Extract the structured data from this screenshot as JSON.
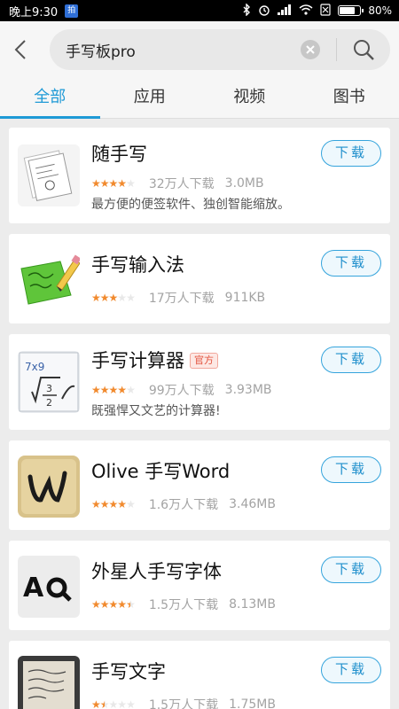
{
  "status_bar": {
    "time": "晚上9:30",
    "notif": "拍",
    "battery": "80%",
    "battery_level": 0.8
  },
  "search": {
    "query": "手写板pro"
  },
  "tabs": [
    "全部",
    "应用",
    "视频",
    "图书"
  ],
  "active_tab": 0,
  "download_label": "下载",
  "colors": {
    "accent": "#1f9ad6",
    "star": "#f18a2e",
    "badge": "#e2513c"
  },
  "apps": [
    {
      "name": "随手写",
      "rating": 4,
      "downloads": "32万人下载",
      "size": "3.0MB",
      "desc": "最方便的便签软件、独创智能缩放。",
      "icon": "notepad-icon"
    },
    {
      "name": "手写输入法",
      "rating": 3,
      "downloads": "17万人下载",
      "size": "911KB",
      "desc": "",
      "icon": "green-pad-pencil-icon"
    },
    {
      "name": "手写计算器",
      "badge": "官方",
      "rating": 4,
      "downloads": "99万人下载",
      "size": "3.93MB",
      "desc": "既强悍又文艺的计算器!",
      "icon": "calculator-handwriting-icon"
    },
    {
      "name": "Olive 手写Word",
      "rating": 4,
      "downloads": "1.6万人下载",
      "size": "3.46MB",
      "desc": "",
      "icon": "olive-w-icon"
    },
    {
      "name": "外星人手写字体",
      "rating": 4.5,
      "downloads": "1.5万人下载",
      "size": "8.13MB",
      "desc": "",
      "icon": "font-aa-icon"
    },
    {
      "name": "手写文字",
      "rating": 1.5,
      "downloads": "1.5万人下载",
      "size": "1.75MB",
      "desc": "",
      "icon": "handwritten-paper-icon"
    }
  ]
}
